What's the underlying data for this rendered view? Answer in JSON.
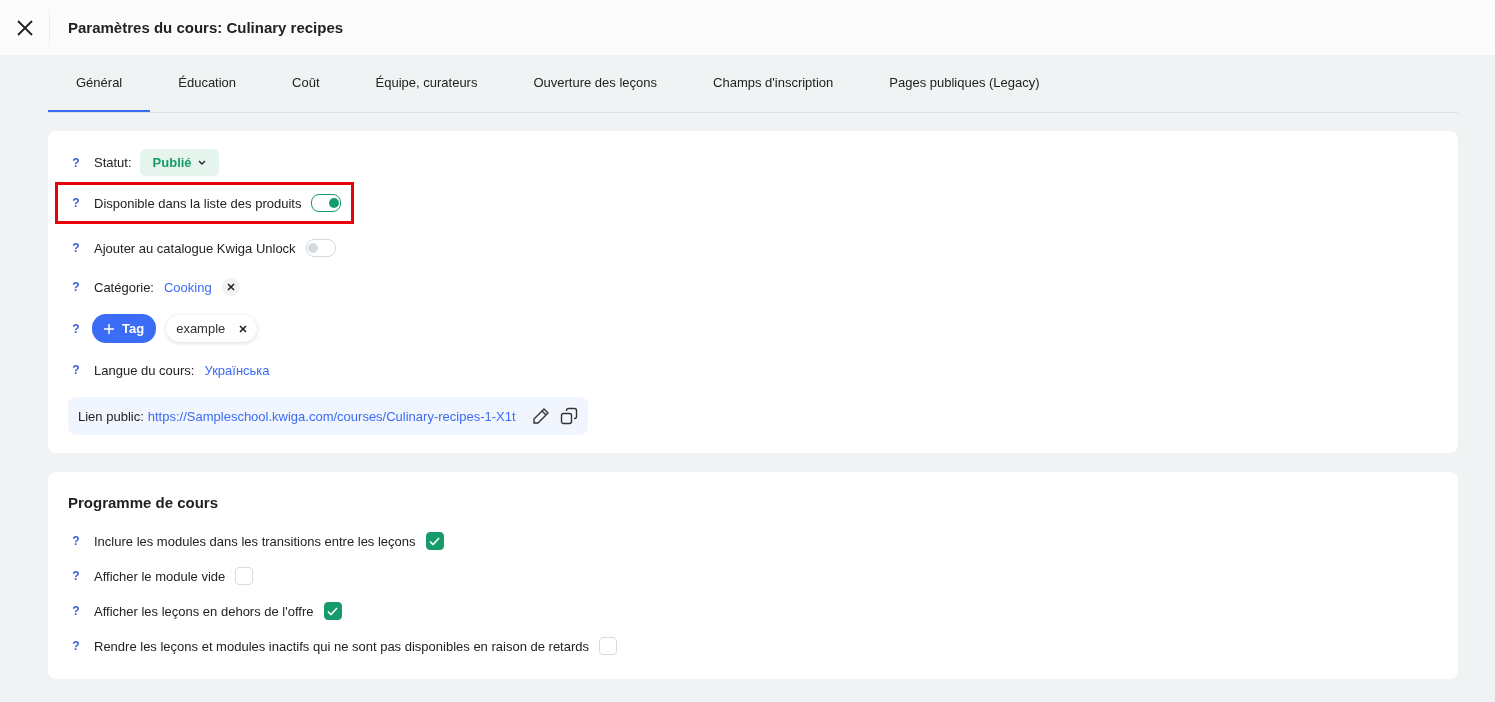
{
  "header": {
    "title": "Paramètres du cours: Culinary recipes"
  },
  "tabs": [
    {
      "label": "Général",
      "selected": true
    },
    {
      "label": "Éducation",
      "selected": false
    },
    {
      "label": "Coût",
      "selected": false
    },
    {
      "label": "Équipe, curateurs",
      "selected": false
    },
    {
      "label": "Ouverture des leçons",
      "selected": false
    },
    {
      "label": "Champs d'inscription",
      "selected": false
    },
    {
      "label": "Pages publiques (Legacy)",
      "selected": false
    }
  ],
  "general": {
    "status": {
      "help": "?",
      "label": "Statut:",
      "value": "Publié"
    },
    "toggles": [
      {
        "help": "?",
        "label": "Disponible dans la liste des produits",
        "on": true,
        "highlighted": true
      },
      {
        "help": "?",
        "label": "Ajouter au catalogue Kwiga Unlock",
        "on": false,
        "highlighted": false
      }
    ],
    "category": {
      "help": "?",
      "label": "Catégorie:",
      "value": "Cooking"
    },
    "tags": {
      "help": "?",
      "button": "Tag",
      "items": [
        "example"
      ]
    },
    "language": {
      "help": "?",
      "label": "Langue du cours:",
      "value": "Українська"
    },
    "public_link": {
      "label": "Lien public:",
      "url": "https://Sampleschool.kwiga.com/courses/Culinary-recipes-1-X1t"
    }
  },
  "program": {
    "title": "Programme de cours",
    "options": [
      {
        "help": "?",
        "label": "Inclure les modules dans les transitions entre les leçons",
        "checked": true
      },
      {
        "help": "?",
        "label": "Afficher le module vide",
        "checked": false
      },
      {
        "help": "?",
        "label": "Afficher les leçons en dehors de l'offre",
        "checked": true
      },
      {
        "help": "?",
        "label": "Rendre les leçons et modules inactifs qui ne sont pas disponibles en raison de retards",
        "checked": false
      }
    ]
  }
}
